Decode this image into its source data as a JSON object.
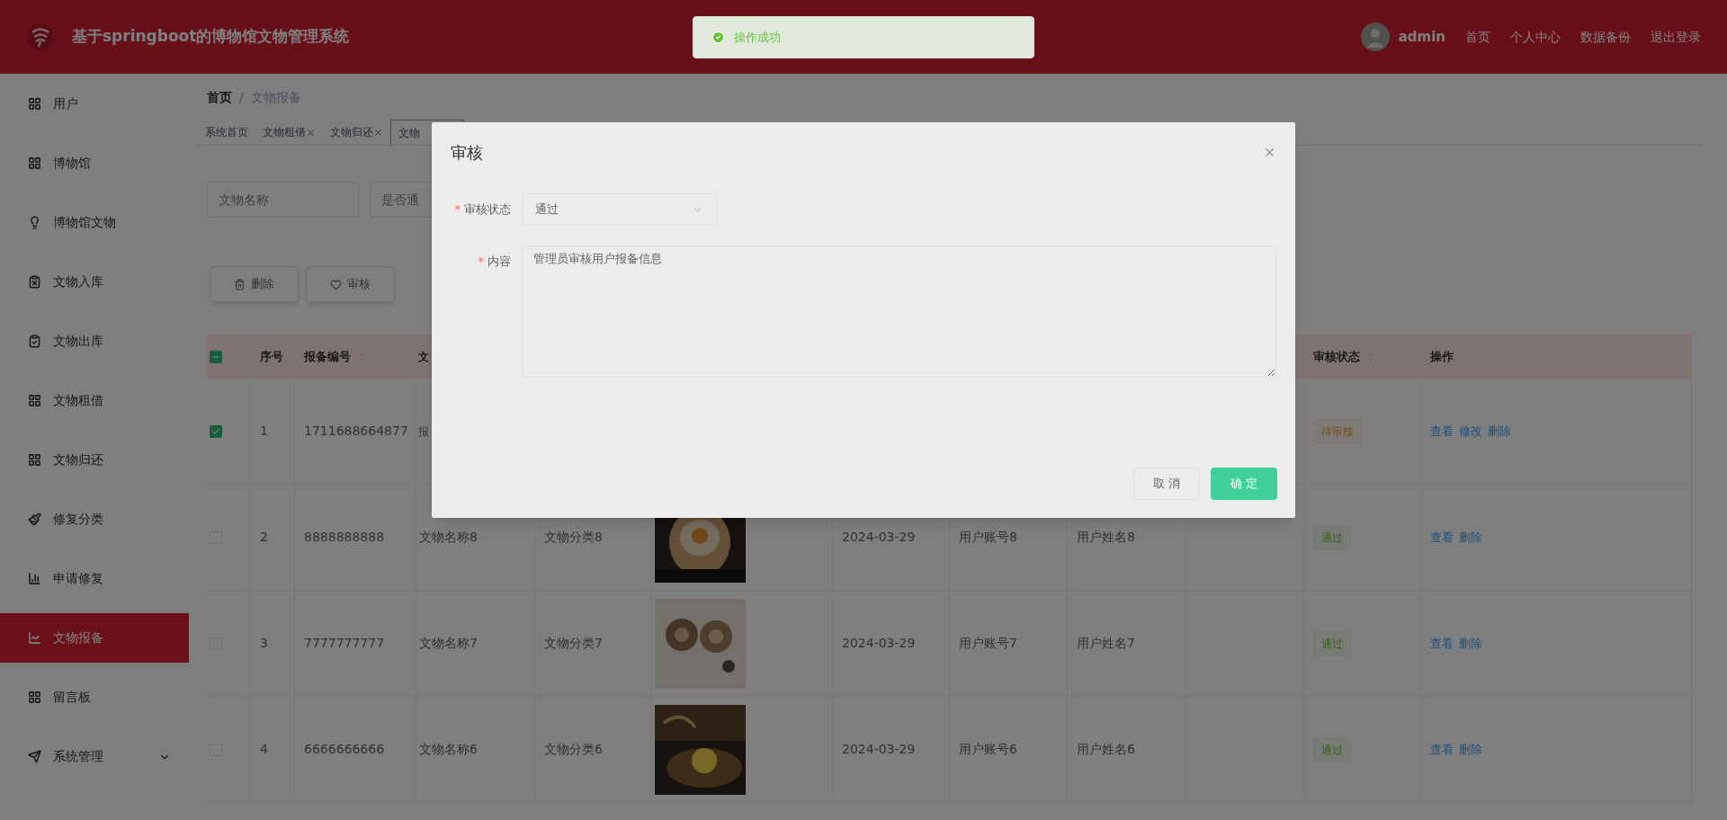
{
  "header": {
    "title": "基于springboot的博物馆文物管理系统",
    "user": "admin",
    "links": [
      "首页",
      "个人中心",
      "数据备份",
      "退出登录"
    ]
  },
  "toast": {
    "text": "操作成功"
  },
  "sidebar": {
    "items": [
      {
        "label": "用户",
        "selected": false
      },
      {
        "label": "博物馆",
        "selected": false
      },
      {
        "label": "博物馆文物",
        "selected": false
      },
      {
        "label": "文物入库",
        "selected": false
      },
      {
        "label": "文物出库",
        "selected": false
      },
      {
        "label": "文物租借",
        "selected": false
      },
      {
        "label": "文物归还",
        "selected": false
      },
      {
        "label": "修复分类",
        "selected": false
      },
      {
        "label": "申请修复",
        "selected": false
      },
      {
        "label": "文物报备",
        "selected": true
      },
      {
        "label": "留言板",
        "selected": false
      },
      {
        "label": "系统管理",
        "selected": false,
        "expandable": true
      }
    ]
  },
  "breadcrumb": {
    "items": [
      "首页",
      "文物报备"
    ],
    "separator": "/"
  },
  "tabs": [
    {
      "label": "系统首页",
      "selected": false
    },
    {
      "label": "文物租借",
      "closable": true,
      "selected": false
    },
    {
      "label": "文物归还",
      "closable": true,
      "selected": false
    },
    {
      "label": "文物",
      "selected": true
    }
  ],
  "search": [
    {
      "placeholder": "文物名称"
    },
    {
      "placeholder": "是否通"
    }
  ],
  "actions": [
    "删除",
    "审核"
  ],
  "table": {
    "header_checkbox": {
      "indeterminate": true
    },
    "columns": [
      "序号",
      "报备编号",
      "文",
      "审核状态",
      "操作"
    ],
    "rows": [
      {
        "checked": true,
        "cells": [
          "1",
          "1711688664877",
          "报",
          "",
          "",
          "",
          "",
          ""
        ],
        "status": {
          "text": "待审核",
          "kind": "warning"
        },
        "ops": [
          "查看",
          "修改",
          "删除"
        ]
      },
      {
        "checked": false,
        "cells": [
          "2",
          "8888888888",
          "文物名称8",
          "文物分类8",
          "2024-03-29",
          "用户账号8",
          "用户姓名8",
          ""
        ],
        "picture": true,
        "status": {
          "text": "通过",
          "kind": "success"
        },
        "ops": [
          "查看",
          "删除"
        ]
      },
      {
        "checked": false,
        "cells": [
          "3",
          "7777777777",
          "文物名称7",
          "文物分类7",
          "2024-03-29",
          "用户账号7",
          "用户姓名7",
          ""
        ],
        "picture": true,
        "status": {
          "text": "通过",
          "kind": "success"
        },
        "ops": [
          "查看",
          "删除"
        ]
      },
      {
        "checked": false,
        "cells": [
          "4",
          "6666666666",
          "文物名称6",
          "文物分类6",
          "2024-03-29",
          "用户账号6",
          "用户姓名6",
          ""
        ],
        "picture": true,
        "status": {
          "text": "通过",
          "kind": "success"
        },
        "ops": [
          "查看",
          "删除"
        ]
      }
    ]
  },
  "dialog": {
    "title": "审核",
    "fields": [
      {
        "marker": "*",
        "label": "审核状态",
        "kind": "select",
        "value": "通过"
      },
      {
        "marker": "*",
        "label": "内容",
        "kind": "textarea",
        "value": "管理员审核用户报备信息"
      }
    ],
    "buttons": [
      {
        "label": "取 消",
        "primary": false
      },
      {
        "label": "确 定",
        "primary": true
      }
    ]
  }
}
